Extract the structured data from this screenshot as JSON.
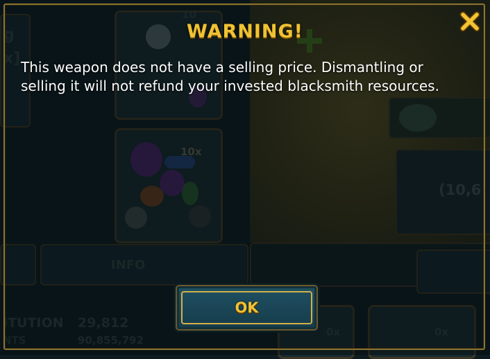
{
  "dialog": {
    "title": "WARNING!",
    "message": "This weapon does not have a selling price. Dismantling or selling it will not refund your invested blacksmith resources.",
    "ok_label": "OK"
  },
  "background": {
    "info_label": "INFO",
    "stat_label_1": "ITUTION",
    "stat_value_1": "29,812",
    "stat_label_2": "NTS",
    "stat_value_2": "90,855,792",
    "count_top": "10",
    "count_mid": "10x",
    "count_a": "0x",
    "count_b": "0x",
    "coords": "(10,6",
    "partial_left_1": "g",
    "partial_left_2": "x]"
  },
  "colors": {
    "title": "#f0c233",
    "frame_gold": "#8a7430",
    "button_blue": "#1f5164"
  }
}
